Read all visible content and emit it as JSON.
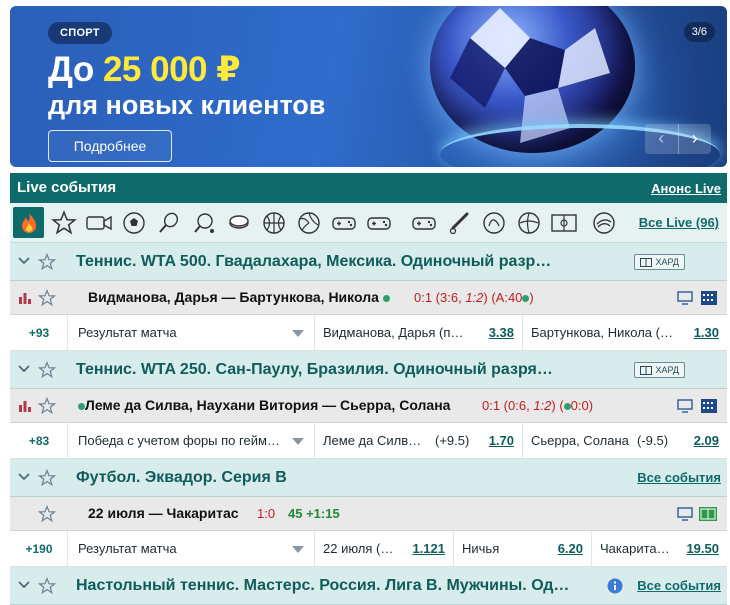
{
  "banner": {
    "badge": "СПОРТ",
    "line1_prefix": "До ",
    "line1_amount": "25 000 ₽",
    "line2": "для новых клиентов",
    "button": "Подробнее",
    "counter": "3/6",
    "prev": "‹",
    "next": "›"
  },
  "live": {
    "title": "Live события",
    "anons": "Анонс Live",
    "all_live": "Все Live (96)",
    "sports": [
      "fire-icon",
      "star-icon",
      "video-icon",
      "soccer-icon",
      "tennis-icon",
      "table-tennis-icon",
      "hockey-icon",
      "basketball-icon",
      "volleyball-icon",
      "esports-icon",
      "esports2-icon",
      "esports3-icon",
      "baseball-icon",
      "handball-icon",
      "beach-volleyball-icon",
      "field-icon",
      "other-icon"
    ]
  },
  "t1": {
    "title": "Теннис. WTA 500. Гвадалахара, Мексика. Одиночный разр…",
    "surface": "ХАРД"
  },
  "m1": {
    "name": "Видманова, Дарья — Бартункова, Никола",
    "score_main": "0:1 (3:6, ",
    "score_set": "1:2",
    "score_tail": ") (A:40",
    "score_end": ")"
  },
  "o1": {
    "count": "+93",
    "market": "Результат матча",
    "c1_label": "Видманова, Дарья (п…",
    "c1_val": "3.38",
    "c2_label": "Бартункова, Никола (…",
    "c2_val": "1.30"
  },
  "t2": {
    "title": "Теннис. WTA 250. Сан-Паулу, Бразилия. Одиночный разря…",
    "surface": "ХАРД"
  },
  "m2": {
    "name": "Леме да Силва, Наухани Витория — Сьерра, Солана",
    "score_main": "0:1 (0:6, ",
    "score_set": "1:2",
    "score_tail": ") (",
    "score_end": "0:0)"
  },
  "o2": {
    "count": "+83",
    "market": "Победа с учетом форы по гейм…",
    "c1_label": "Леме да Силв…",
    "c1_hcp": "(+9.5)",
    "c1_val": "1.70",
    "c2_label": "Сьерра, Солана",
    "c2_hcp": "(-9.5)",
    "c2_val": "2.09"
  },
  "t3": {
    "title": "Футбол. Эквадор. Серия B",
    "all": "Все события"
  },
  "m3": {
    "name": "22 июля — Чакаритас",
    "score_main": "1:0",
    "time": "45 +1:15"
  },
  "o3": {
    "count": "+190",
    "market": "Результат матча",
    "c1_label": "22 июля (…",
    "c1_val": "1.121",
    "c2_label": "Ничья",
    "c2_val": "6.20",
    "c3_label": "Чакарита…",
    "c3_val": "19.50"
  },
  "t4": {
    "title": "Настольный теннис. Мастерс. Россия. Лига B. Мужчины. Од…",
    "all": "Все события"
  },
  "colors": {
    "header": "#0f6b6b",
    "tournament_bg": "#d9ecec",
    "match_bg": "#e9e9e9",
    "score_red": "#c41d1d",
    "amount_yellow": "#ffe93b"
  }
}
